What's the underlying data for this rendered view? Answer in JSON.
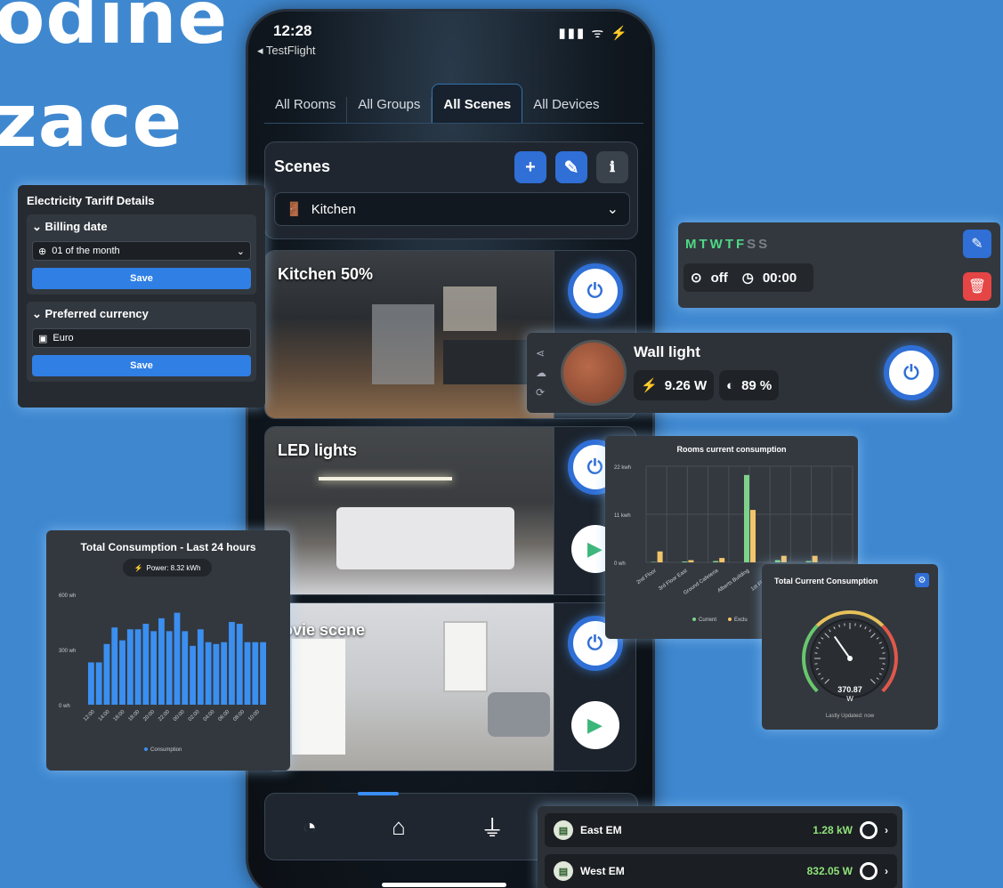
{
  "headline": {
    "line1": "odine",
    "line2": "zace"
  },
  "phone": {
    "status_time": "12:28",
    "back_label": "◂ TestFlight",
    "status_icons": "▮▮▮ ᯤ ⚡",
    "tabs": [
      "All Rooms",
      "All Groups",
      "All Scenes",
      "All Devices"
    ],
    "scenes_title": "Scenes",
    "room_selected": "Kitchen",
    "scenes": [
      {
        "label": "Kitchen 50%"
      },
      {
        "label": "LED lights"
      },
      {
        "label": "ovie scene"
      }
    ]
  },
  "tariff": {
    "title": "Electricity Tariff Details",
    "billing_label": "Billing date",
    "billing_value": "01 of the month",
    "save_label": "Save",
    "currency_label": "Preferred currency",
    "currency_value": "Euro"
  },
  "schedule": {
    "days_active": "MTWTF",
    "days_inactive": "SS",
    "off_label": "off",
    "time": "00:00"
  },
  "wall_light": {
    "title": "Wall light",
    "power": "9.26 W",
    "brightness": "89 %"
  },
  "rooms_chart": {
    "chart_data": {
      "type": "bar",
      "title": "Rooms current consumption",
      "ylabel": "",
      "y_ticks": [
        "22 kwh",
        "11 kwh",
        "0 wh"
      ],
      "ylim": [
        0,
        22
      ],
      "categories": [
        "2nd Floor",
        "3rd Floor East",
        "Ground Cafeteria",
        "Alberts Building",
        "1st Floor West",
        "1st Floo"
      ],
      "series": [
        {
          "name": "Current",
          "color": "#7ed38a",
          "values": [
            0.1,
            0.2,
            0.3,
            20,
            0.5,
            0.3
          ]
        },
        {
          "name": "Exclu",
          "color": "#f2c46b",
          "values": [
            2.5,
            0.5,
            1,
            12,
            1.5,
            1.5
          ]
        }
      ],
      "legend": "bottom"
    }
  },
  "total24": {
    "title": "Total Consumption - Last 24 hours",
    "power_label": "Power: 8.32 kWh",
    "chart_data": {
      "type": "bar",
      "title": "Total Consumption - Last 24 hours",
      "y_ticks": [
        "600 wh",
        "300 wh",
        "0 wh"
      ],
      "ylim": [
        0,
        600
      ],
      "x_labels": [
        "12:00",
        "14:00",
        "16:00",
        "18:00",
        "20:00",
        "22:00",
        "00:00",
        "02:00",
        "04:00",
        "06:00",
        "08:00",
        "10:00"
      ],
      "series": [
        {
          "name": "Consumption",
          "color": "#3b8ff0",
          "values": [
            230,
            230,
            330,
            420,
            350,
            410,
            410,
            440,
            400,
            470,
            400,
            500,
            400,
            320,
            410,
            340,
            330,
            340,
            450,
            440,
            340,
            340,
            340
          ]
        }
      ],
      "legend": "bottom"
    }
  },
  "gauge": {
    "title": "Total Current Consumption",
    "value": "370.87",
    "unit": "W",
    "updated": "Lastly Updated: now",
    "level": 0.37
  },
  "energy_meters": [
    {
      "name": "East EM",
      "value": "1.28 kW"
    },
    {
      "name": "West EM",
      "value": "832.05 W"
    }
  ]
}
